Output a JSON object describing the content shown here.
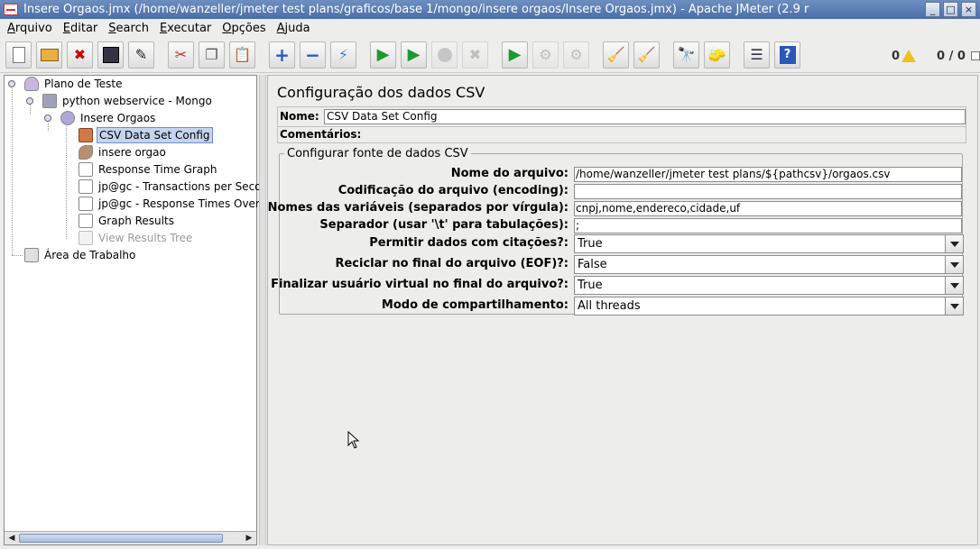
{
  "window": {
    "title": "Insere Orgaos.jmx (/home/wanzeller/jmeter test plans/graficos/base 1/mongo/insere orgaos/Insere Orgaos.jmx) - Apache JMeter (2.9 r",
    "buttons": [
      "_",
      "□",
      "×"
    ]
  },
  "menu": [
    {
      "label": "Arquivo"
    },
    {
      "label": "Editar"
    },
    {
      "label": "Search"
    },
    {
      "label": "Executar"
    },
    {
      "label": "Opções"
    },
    {
      "label": "Ajuda"
    }
  ],
  "toolbar": {
    "icons": [
      "new-icon",
      "open-icon",
      "close-icon",
      "save-icon",
      "save-as-icon",
      "cut-icon",
      "copy-icon",
      "paste-icon",
      "expand-icon",
      "collapse-icon",
      "toggle-icon",
      "start-icon",
      "start-no-pause-icon",
      "stop-icon",
      "shutdown-icon",
      "remote-start-icon",
      "remote-stop-icon",
      "remote-shutdown-icon",
      "clear-icon",
      "clear-all-icon",
      "search-icon",
      "reset-search-icon",
      "function-helper-icon",
      "help-icon"
    ],
    "warnings_count": "0",
    "threads": "0 / 0"
  },
  "tree": {
    "nodes": [
      {
        "label": "Plano de Teste",
        "icon": "test-plan-icon"
      },
      {
        "label": "python webservice - Mongo",
        "icon": "thread-group-icon"
      },
      {
        "label": "Insere Orgaos",
        "icon": "controller-icon"
      },
      {
        "label": "CSV Data Set Config",
        "icon": "config-element-icon"
      },
      {
        "label": "insere orgao",
        "icon": "sampler-icon"
      },
      {
        "label": "Response Time Graph",
        "icon": "graph-listener-icon"
      },
      {
        "label": "jp@gc - Transactions per Seco",
        "icon": "graph-listener-icon"
      },
      {
        "label": "jp@gc - Response Times Over",
        "icon": "graph-listener-icon"
      },
      {
        "label": "Graph Results",
        "icon": "graph-listener-icon"
      },
      {
        "label": "View Results Tree",
        "icon": "results-tree-icon"
      },
      {
        "label": "Área de Trabalho",
        "icon": "workbench-icon"
      }
    ]
  },
  "panel": {
    "title": "Configuração dos dados CSV",
    "name_label": "Nome:",
    "name_value": "CSV Data Set Config",
    "comments_label": "Comentários:",
    "group_title": "Configurar fonte de dados CSV",
    "fields": [
      {
        "label": "Nome do arquivo:",
        "value": "/home/wanzeller/jmeter test plans/${pathcsv}/orgaos.csv"
      },
      {
        "label": "Codificação do arquivo (encoding):",
        "value": ""
      },
      {
        "label": "Nomes das variáveis (separados por vírgula):",
        "value": "cnpj,nome,endereco,cidade,uf"
      },
      {
        "label": "Separador (usar '\\t' para tabulações):",
        "value": ";"
      }
    ],
    "combos": [
      {
        "label": "Permitir dados com citações?:",
        "value": "True"
      },
      {
        "label": "Reciclar no final do arquivo (EOF)?:",
        "value": "False"
      },
      {
        "label": "Finalizar usuário virtual no final do arquivo?:",
        "value": "True"
      },
      {
        "label": "Modo de compartilhamento:",
        "value": "All threads"
      }
    ]
  }
}
